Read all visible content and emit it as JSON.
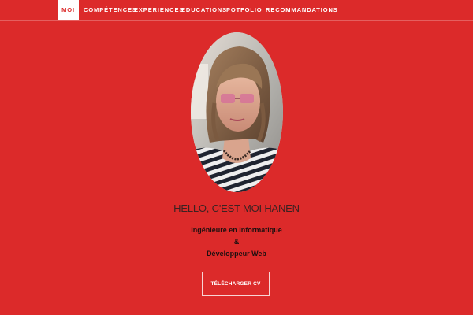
{
  "nav": {
    "items": [
      {
        "label": "MOI",
        "active": true
      },
      {
        "label": "COMPÉTENCES"
      },
      {
        "label": "EXPERIENCES"
      },
      {
        "label": "EDUCATIONS"
      },
      {
        "label": "POTFOLIO"
      },
      {
        "label": "RECOMMANDATIONS"
      }
    ]
  },
  "hero": {
    "greeting": "HELLO, C'EST MOI HANEN",
    "line1": "Ingénieure en Informatique",
    "line2": "&",
    "line3": "Développeur Web",
    "cv_button": "TÉLÉCHARGER CV"
  },
  "colors": {
    "background": "#dc2a2a",
    "nav_text": "#ffffff",
    "active_bg": "#ffffff",
    "heading": "#3c2222"
  }
}
